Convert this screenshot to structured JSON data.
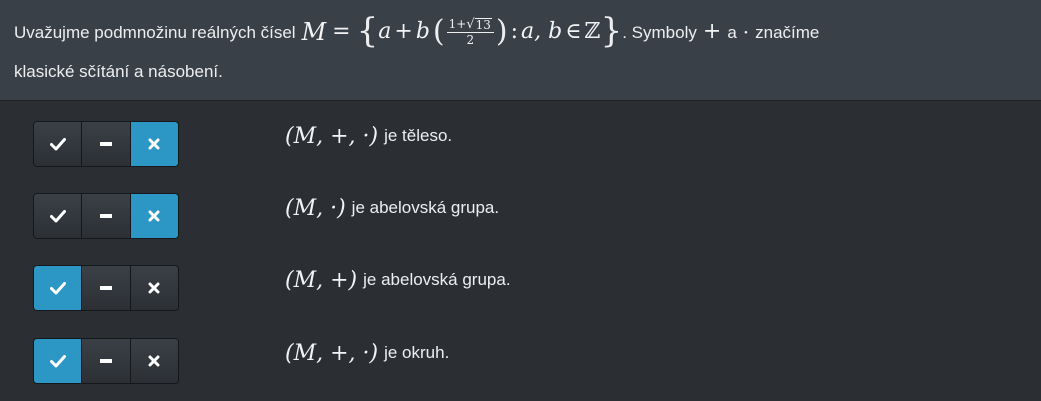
{
  "question": {
    "intro": "Uvažujme podmnožinu reálných čísel",
    "set_name": "M",
    "eq": "=",
    "lbrace": "{",
    "a": "a",
    "plus": "+",
    "b": "b",
    "lparen": "(",
    "frac_num_prefix": "1+",
    "sqrt_arg": "13",
    "frac_den": "2",
    "rparen": ")",
    "colon": ":",
    "vars": "a, b",
    "in": "∈",
    "Z": "ℤ",
    "rbrace": "}",
    "after_set": ". Symboly",
    "plus_sym": "+",
    "and": "a",
    "dot_sym": "·",
    "line1_end": "značíme",
    "line2": "klasické sčítání a násobení."
  },
  "statements": [
    {
      "math": "(M, +, ·)",
      "text": "je těleso.",
      "selected": "false"
    },
    {
      "math": "(M, ·)",
      "text": "je abelovská grupa.",
      "selected": "false"
    },
    {
      "math": "(M, +)",
      "text": "je abelovská grupa.",
      "selected": "true"
    },
    {
      "math": "(M, +, ·)",
      "text": "je okruh.",
      "selected": "true"
    }
  ],
  "options": [
    "true",
    "neutral",
    "false"
  ],
  "icons": {
    "true": "check-icon",
    "neutral": "minus-icon",
    "false": "cross-icon"
  },
  "colors": {
    "header_bg": "#3a4047",
    "page_bg": "#2b2f33",
    "active": "#2c97c4",
    "button_bg": "#33383d"
  }
}
